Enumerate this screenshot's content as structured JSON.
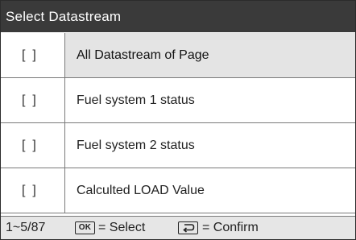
{
  "header": {
    "title": "Select Datastream"
  },
  "list": {
    "items": [
      {
        "checkbox": "[  ]",
        "label": "All Datastream of Page",
        "selected": true
      },
      {
        "checkbox": "[  ]",
        "label": "Fuel system 1 status",
        "selected": false
      },
      {
        "checkbox": "[  ]",
        "label": "Fuel system 2 status",
        "selected": false
      },
      {
        "checkbox": "[  ]",
        "label": "Calculted LOAD Value",
        "selected": false
      }
    ]
  },
  "footer": {
    "page_count": "1~5/87",
    "ok_key_label": "OK",
    "ok_action": "= Select",
    "back_key_icon": "return-arrow-icon",
    "back_action": "= Confirm"
  },
  "colors": {
    "title_bar": "#3a3a3a",
    "highlight_row": "#e4e4e4",
    "status_bar": "#e6e6e6"
  }
}
